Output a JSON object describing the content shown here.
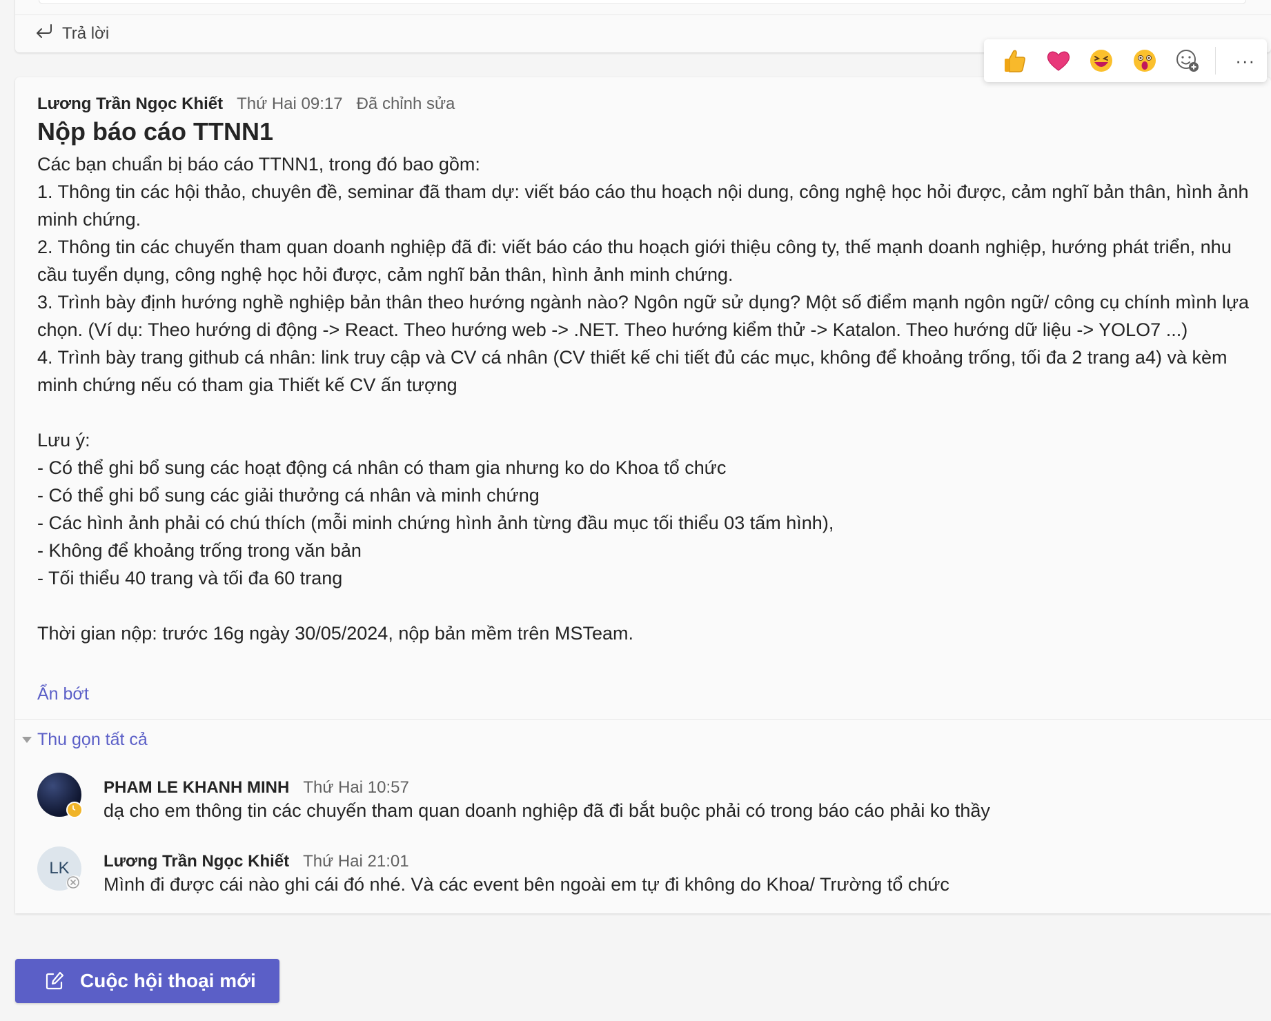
{
  "previous_thread": {
    "reply_label": "Trả lời"
  },
  "reaction_bar": {
    "reactions": [
      "like",
      "heart",
      "laugh",
      "surprised",
      "add-reaction"
    ],
    "more_label": "···"
  },
  "post": {
    "author": "Lương Trần Ngọc Khiết",
    "time": "Thứ Hai 09:17",
    "edited": "Đã chỉnh sửa",
    "title": "Nộp báo cáo TTNN1",
    "body_lines": [
      "Các bạn chuẩn bị báo cáo TTNN1, trong đó bao gồm:",
      "1. Thông tin các hội thảo, chuyên đề, seminar đã tham dự: viết báo cáo thu hoạch nội dung, công nghệ học hỏi được, cảm nghĩ bản thân, hình ảnh minh chứng.",
      "2. Thông tin các chuyến tham quan doanh nghiệp đã đi: viết báo cáo thu hoạch giới thiệu công ty, thế mạnh doanh nghiệp, hướng phát triển, nhu cầu tuyển dụng, công nghệ học hỏi được, cảm nghĩ bản thân, hình ảnh minh chứng.",
      "3. Trình bày định hướng nghề nghiệp bản thân theo hướng ngành nào? Ngôn ngữ sử dụng? Một số điểm mạnh ngôn ngữ/ công cụ chính mình lựa chọn. (Ví dụ: Theo hướng di động -> React. Theo hướng web -> .NET. Theo hướng kiểm thử -> Katalon. Theo hướng dữ liệu -> YOLO7  ...)",
      "4. Trình bày trang github cá nhân: link truy cập và CV cá nhân (CV thiết kế chi tiết đủ các mục, không để khoảng trống, tối đa 2 trang a4) và kèm minh chứng nếu có tham gia Thiết kế CV ấn tượng"
    ],
    "note_label": "Lưu ý:",
    "notes": [
      "- Có thể ghi bổ sung các hoạt động cá nhân có tham gia nhưng ko do Khoa tổ chức",
      "- Có thể ghi bổ sung các giải thưởng cá nhân và minh chứng",
      "- Các hình ảnh phải có chú thích (mỗi minh chứng hình ảnh từng đầu mục tối thiểu 03 tấm hình),",
      "- Không để khoảng trống trong văn bản",
      "- Tối thiểu 40 trang và tối đa 60 trang"
    ],
    "deadline": "Thời gian nộp:  trước 16g ngày 30/05/2024, nộp bản mềm trên MSTeam.",
    "hide_label": "Ẩn bớt",
    "collapse_all_label": "Thu gọn tất cả"
  },
  "replies": [
    {
      "author": "PHAM LE KHANH MINH",
      "time": "Thứ Hai 10:57",
      "text": "dạ cho em thông tin các chuyến tham quan doanh nghiệp đã đi bắt buộc phải có trong báo cáo phải ko thầy",
      "presence": "away"
    },
    {
      "author": "Lương Trần Ngọc Khiết",
      "initials": "LK",
      "time": "Thứ Hai 21:01",
      "text": "Mình đi được cái nào ghi cái đó nhé. Và các event bên ngoài em tự đi không do Khoa/ Trường tổ chức",
      "presence": "offline"
    }
  ],
  "new_conversation_label": "Cuộc hội thoại mới",
  "colors": {
    "accent": "#5b5fc7",
    "background": "#f5f5f5",
    "card": "#fafafa",
    "away": "#f0b429"
  }
}
